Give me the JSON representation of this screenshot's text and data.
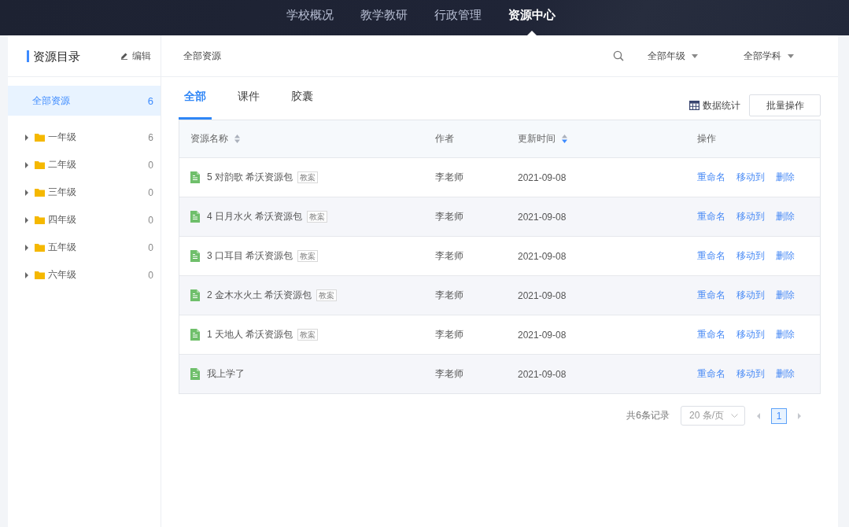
{
  "nav": [
    {
      "label": "学校概况",
      "selected": false
    },
    {
      "label": "教学教研",
      "selected": false
    },
    {
      "label": "行政管理",
      "selected": false
    },
    {
      "label": "资源中心",
      "selected": true
    }
  ],
  "sidebar": {
    "title": "资源目录",
    "edit_label": "编辑",
    "all_item": {
      "label": "全部资源",
      "count": "6",
      "selected": true
    },
    "items": [
      {
        "label": "一年级",
        "count": "6",
        "expanded": false,
        "selected": false
      },
      {
        "label": "二年级",
        "count": "0",
        "expanded": false,
        "selected": false
      },
      {
        "label": "三年级",
        "count": "0",
        "expanded": false,
        "selected": false
      },
      {
        "label": "四年级",
        "count": "0",
        "expanded": false,
        "selected": false
      },
      {
        "label": "五年级",
        "count": "0",
        "expanded": false,
        "selected": false
      },
      {
        "label": "六年级",
        "count": "0",
        "expanded": false,
        "selected": false
      }
    ]
  },
  "breadcrumb": "全部资源",
  "filters": [
    "全部年级",
    "全部学科"
  ],
  "tabs": [
    {
      "label": "全部",
      "selected": true
    },
    {
      "label": "课件",
      "selected": false
    },
    {
      "label": "胶囊",
      "selected": false
    }
  ],
  "stats_label": "数据统计",
  "batch_button": "批量操作",
  "table": {
    "columns": [
      {
        "label": "资源名称",
        "sortable": true,
        "descending": false
      },
      {
        "label": "作者",
        "sortable": false
      },
      {
        "label": "更新时间",
        "sortable": true,
        "descending": true
      },
      {
        "label": "操作",
        "sortable": false
      }
    ],
    "rows": [
      {
        "name": "5 对韵歌 希沃资源包",
        "tag": "教案",
        "author": "李老师",
        "date": "2021-09-08",
        "actions": [
          "重命名",
          "移动到",
          "删除"
        ]
      },
      {
        "name": "4 日月水火 希沃资源包",
        "tag": "教案",
        "author": "李老师",
        "date": "2021-09-08",
        "actions": [
          "重命名",
          "移动到",
          "删除"
        ]
      },
      {
        "name": "3 口耳目 希沃资源包",
        "tag": "教案",
        "author": "李老师",
        "date": "2021-09-08",
        "actions": [
          "重命名",
          "移动到",
          "删除"
        ]
      },
      {
        "name": "2 金木水火土 希沃资源包",
        "tag": "教案",
        "author": "李老师",
        "date": "2021-09-08",
        "actions": [
          "重命名",
          "移动到",
          "删除"
        ]
      },
      {
        "name": "1 天地人 希沃资源包",
        "tag": "教案",
        "author": "李老师",
        "date": "2021-09-08",
        "actions": [
          "重命名",
          "移动到",
          "删除"
        ]
      },
      {
        "name": "我上学了",
        "author": "李老师",
        "date": "2021-09-08",
        "actions": [
          "重命名",
          "移动到",
          "删除"
        ]
      }
    ]
  },
  "pagination": {
    "total": "共6条记录",
    "page_size": "20 条/页",
    "pages": [
      {
        "label": "1",
        "selected": true
      }
    ]
  }
}
